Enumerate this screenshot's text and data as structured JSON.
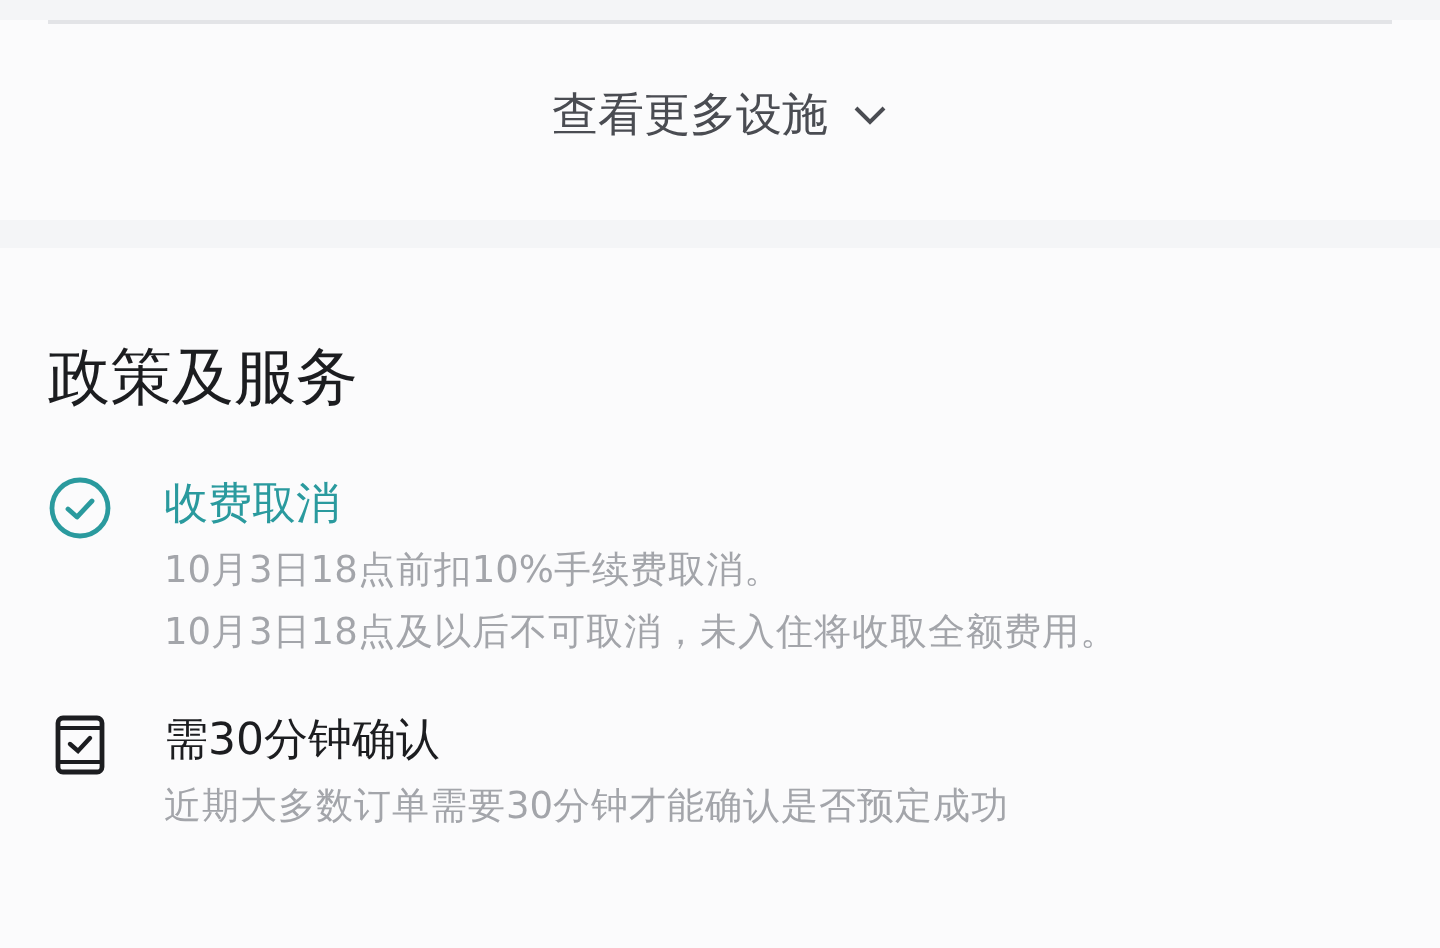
{
  "facilities": {
    "more_link": "查看更多设施"
  },
  "policies": {
    "title": "政策及服务",
    "items": [
      {
        "kind": "check",
        "title": "收费取消",
        "lines": [
          "10月3日18点前扣10%手续费取消。",
          "10月3日18点及以后不可取消，未入住将收取全额费用。"
        ]
      },
      {
        "kind": "document",
        "title": "需30分钟确认",
        "lines": [
          "近期大多数订单需要30分钟才能确认是否预定成功"
        ]
      }
    ]
  }
}
